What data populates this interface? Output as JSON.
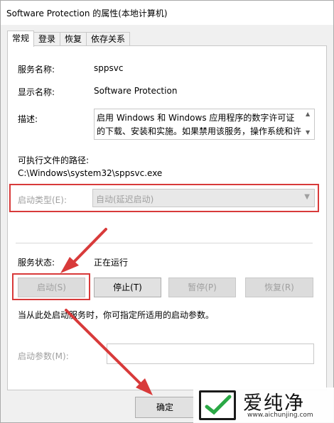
{
  "window": {
    "title": "Software Protection 的属性(本地计算机)"
  },
  "tabs": [
    {
      "label": "常规",
      "active": true
    },
    {
      "label": "登录",
      "active": false
    },
    {
      "label": "恢复",
      "active": false
    },
    {
      "label": "依存关系",
      "active": false
    }
  ],
  "general": {
    "service_name_label": "服务名称:",
    "service_name_value": "sppsvc",
    "display_name_label": "显示名称:",
    "display_name_value": "Software Protection",
    "description_label": "描述:",
    "description_value": "启用 Windows 和 Windows 应用程序的数字许可证的下载、安装和实施。如果禁用该服务，操作系统和许",
    "exe_path_label": "可执行文件的路径:",
    "exe_path_value": "C:\\Windows\\system32\\sppsvc.exe",
    "startup_type_label": "启动类型(E):",
    "startup_type_value": "自动(延迟启动)",
    "service_status_label": "服务状态:",
    "service_status_value": "正在运行",
    "buttons": {
      "start": "启动(S)",
      "stop": "停止(T)",
      "pause": "暂停(P)",
      "resume": "恢复(R)"
    },
    "start_params_hint": "当从此处启动服务时，你可指定所适用的启动参数。",
    "start_params_label": "启动参数(M):",
    "start_params_value": ""
  },
  "footer": {
    "ok_label": "确定"
  },
  "watermark": {
    "brand": "爱纯净",
    "url": "www.aichunjing.com"
  },
  "colors": {
    "highlight_red": "#d83a3a",
    "panel_bg": "#ffffff",
    "window_bg": "#f0f0f0",
    "disabled_text": "#a0a0a0"
  }
}
